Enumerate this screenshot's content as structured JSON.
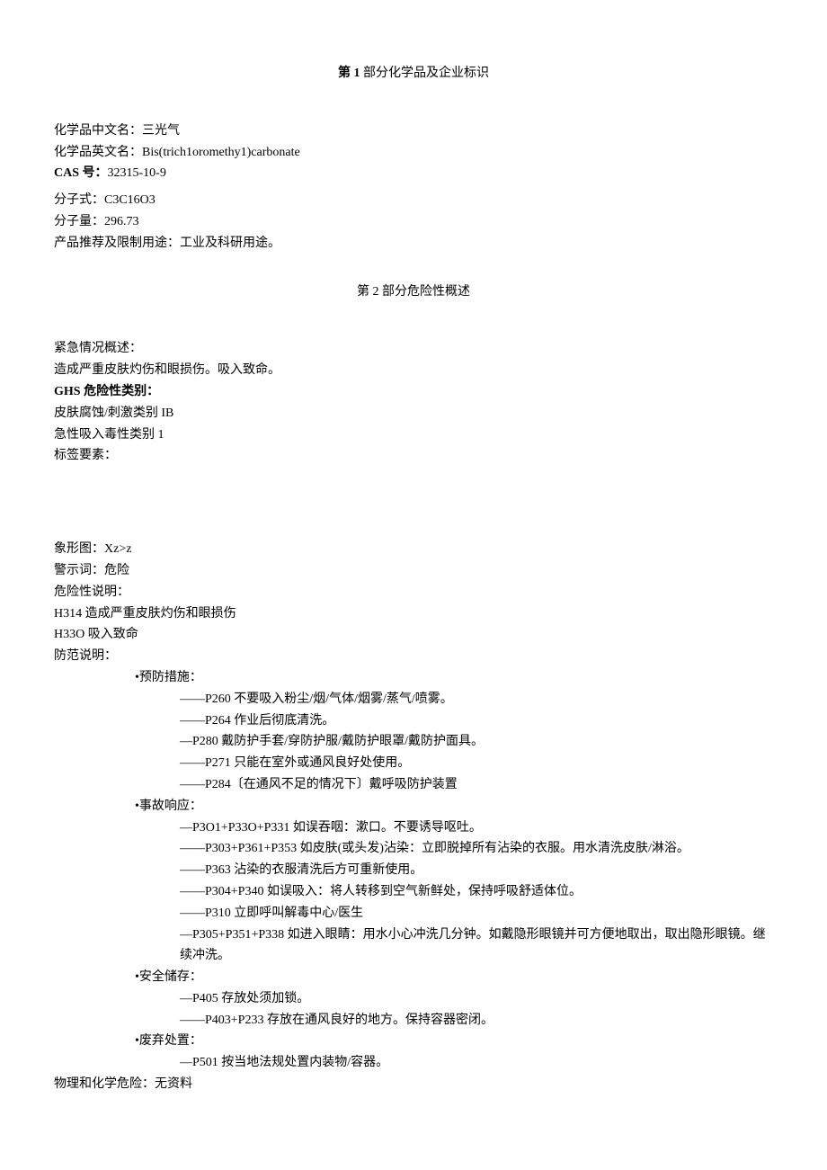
{
  "section1": {
    "title_bold": "第 1 ",
    "title_rest": "部分化学品及企业标识",
    "name_cn_label": "化学品中文名：",
    "name_cn_value": "三光气",
    "name_en_label": "化学品英文名：",
    "name_en_value": "Bis(trich1oromethy1)carbonate",
    "cas_label": "CAS 号：",
    "cas_value": "32315-10-9",
    "formula_label": "分子式：",
    "formula_value": "C3C16O3",
    "mw_label": "分子量：",
    "mw_value": "296.73",
    "usage_label": "产品推荐及限制用途：",
    "usage_value": "工业及科研用途。"
  },
  "section2": {
    "title": "第 2 部分危险性概述",
    "emergency_label": "紧急情况概述：",
    "emergency_value": "造成严重皮肤灼伤和眼损伤。吸入致命。",
    "ghs_label": "GHS 危险性类别：",
    "ghs_line1": "皮肤腐蚀/刺激类别 IB",
    "ghs_line2": "急性吸入毒性类别 1",
    "tag_label": "标签要素：",
    "picto_label": "象形图：",
    "picto_value": "Xz>z",
    "signal_label": "警示词：",
    "signal_value": "危险",
    "hazard_label": "危险性说明：",
    "h314": "H314 造成严重皮肤灼伤和眼损伤",
    "h330": "H33O 吸入致命",
    "precaution_label": "防范说明：",
    "prevent_header": "•预防措施：",
    "p260": "——P260 不要吸入粉尘/烟/气体/烟雾/蒸气/喷雾。",
    "p264": "——P264 作业后彻底清洗。",
    "p280": "—P280 戴防护手套/穿防护服/戴防护眼罩/戴防护面具。",
    "p271": "——P271 只能在室外或通风良好处使用。",
    "p284": "——P284〔在通风不足的情况下〕戴呼吸防护装置",
    "response_header": "•事故响应：",
    "p301": "—P3O1+P33O+P331 如误吞咽：漱口。不要诱导呕吐。",
    "p303": "——P303+P361+P353 如皮肤(或头发)沾染：立即脱掉所有沾染的衣服。用水清洗皮肤/淋浴。",
    "p363": "——P363 沾染的衣服清洗后方可重新使用。",
    "p304": "——P304+P340 如误吸入：将人转移到空气新鲜处，保持呼吸舒适体位。",
    "p310": "——P310 立即呼叫解毒中心/医生",
    "p305": "—P305+P351+P338 如进入眼睛：用水小心冲洗几分钟。如戴隐形眼镜并可方便地取出，取出隐形眼镜。继续冲洗。",
    "storage_header": "•安全储存：",
    "p405": "—P405 存放处须加锁。",
    "p403": "——P403+P233 存放在通风良好的地方。保持容器密闭。",
    "disposal_header": "•废弃处置：",
    "p501": "—P501 按当地法规处置内装物/容器。",
    "phys_label": "物理和化学危险：",
    "phys_value": "无资料"
  }
}
